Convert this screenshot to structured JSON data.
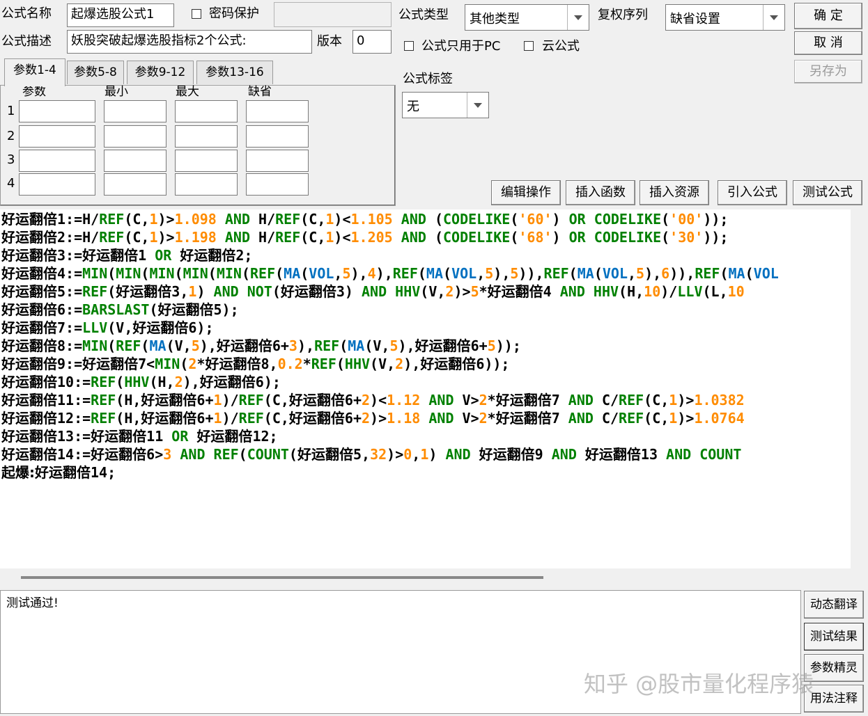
{
  "form": {
    "name_label": "公式名称",
    "name_value": "起爆选股公式1",
    "password_label": "密码保护",
    "desc_label": "公式描述",
    "desc_value": "妖股突破起爆选股指标2个公式:",
    "version_label": "版本",
    "version_value": "0",
    "type_label": "公式类型",
    "type_value": "其他类型",
    "rights_label": "复权序列",
    "rights_value": "缺省设置",
    "pc_only_label": "公式只用于PC",
    "cloud_label": "云公式",
    "tag_label": "公式标签",
    "tag_value": "无"
  },
  "buttons": {
    "ok": "确 定",
    "cancel": "取 消",
    "save_as": "另存为",
    "edit_ops": "编辑操作",
    "insert_func": "插入函数",
    "insert_res": "插入资源",
    "import_formula": "引入公式",
    "test_formula": "测试公式",
    "dyn_translate": "动态翻译",
    "test_result": "测试结果",
    "param_wizard": "参数精灵",
    "usage_notes": "用法注释"
  },
  "tabs": [
    "参数1-4",
    "参数5-8",
    "参数9-12",
    "参数13-16"
  ],
  "params": {
    "headers": [
      "参数",
      "最小",
      "最大",
      "缺省"
    ],
    "rows": [
      "1",
      "2",
      "3",
      "4"
    ]
  },
  "code_lines": [
    [
      [
        "好运翻倍",
        "cn"
      ],
      [
        "1:=H/",
        "t"
      ],
      [
        "REF",
        "fn"
      ],
      [
        "(C,",
        "t"
      ],
      [
        "1",
        "num"
      ],
      [
        ")>",
        "t"
      ],
      [
        "1.098",
        "num"
      ],
      [
        " ",
        "t"
      ],
      [
        "AND",
        "kw"
      ],
      [
        " H/",
        "t"
      ],
      [
        "REF",
        "fn"
      ],
      [
        "(C,",
        "t"
      ],
      [
        "1",
        "num"
      ],
      [
        ")<",
        "t"
      ],
      [
        "1.105",
        "num"
      ],
      [
        " ",
        "t"
      ],
      [
        "AND",
        "kw"
      ],
      [
        " (",
        "t"
      ],
      [
        "CODELIKE",
        "fn"
      ],
      [
        "(",
        "t"
      ],
      [
        "'60'",
        "str"
      ],
      [
        ") ",
        "t"
      ],
      [
        "OR",
        "kw"
      ],
      [
        " ",
        "t"
      ],
      [
        "CODELIKE",
        "fn"
      ],
      [
        "(",
        "t"
      ],
      [
        "'00'",
        "str"
      ],
      [
        "));",
        "t"
      ]
    ],
    [
      [
        "好运翻倍",
        "cn"
      ],
      [
        "2:=H/",
        "t"
      ],
      [
        "REF",
        "fn"
      ],
      [
        "(C,",
        "t"
      ],
      [
        "1",
        "num"
      ],
      [
        ")>",
        "t"
      ],
      [
        "1.198",
        "num"
      ],
      [
        " ",
        "t"
      ],
      [
        "AND",
        "kw"
      ],
      [
        " H/",
        "t"
      ],
      [
        "REF",
        "fn"
      ],
      [
        "(C,",
        "t"
      ],
      [
        "1",
        "num"
      ],
      [
        ")<",
        "t"
      ],
      [
        "1.205",
        "num"
      ],
      [
        " ",
        "t"
      ],
      [
        "AND",
        "kw"
      ],
      [
        " (",
        "t"
      ],
      [
        "CODELIKE",
        "fn"
      ],
      [
        "(",
        "t"
      ],
      [
        "'68'",
        "str"
      ],
      [
        ") ",
        "t"
      ],
      [
        "OR",
        "kw"
      ],
      [
        " ",
        "t"
      ],
      [
        "CODELIKE",
        "fn"
      ],
      [
        "(",
        "t"
      ],
      [
        "'30'",
        "str"
      ],
      [
        "));",
        "t"
      ]
    ],
    [
      [
        "好运翻倍",
        "cn"
      ],
      [
        "3:=",
        "t"
      ],
      [
        "好运翻倍",
        "cn"
      ],
      [
        "1 ",
        "t"
      ],
      [
        "OR",
        "kw"
      ],
      [
        " ",
        "t"
      ],
      [
        "好运翻倍",
        "cn"
      ],
      [
        "2;",
        "t"
      ]
    ],
    [
      [
        "好运翻倍",
        "cn"
      ],
      [
        "4:=",
        "t"
      ],
      [
        "MIN",
        "fn"
      ],
      [
        "(",
        "t"
      ],
      [
        "MIN",
        "fn"
      ],
      [
        "(",
        "t"
      ],
      [
        "MIN",
        "fn"
      ],
      [
        "(",
        "t"
      ],
      [
        "MIN",
        "fn"
      ],
      [
        "(",
        "t"
      ],
      [
        "MIN",
        "fn"
      ],
      [
        "(",
        "t"
      ],
      [
        "REF",
        "fn"
      ],
      [
        "(",
        "t"
      ],
      [
        "MA",
        "var"
      ],
      [
        "(",
        "t"
      ],
      [
        "VOL",
        "var"
      ],
      [
        ",",
        "t"
      ],
      [
        "5",
        "num"
      ],
      [
        "),",
        "t"
      ],
      [
        "4",
        "num"
      ],
      [
        "),",
        "t"
      ],
      [
        "REF",
        "fn"
      ],
      [
        "(",
        "t"
      ],
      [
        "MA",
        "var"
      ],
      [
        "(",
        "t"
      ],
      [
        "VOL",
        "var"
      ],
      [
        ",",
        "t"
      ],
      [
        "5",
        "num"
      ],
      [
        "),",
        "t"
      ],
      [
        "5",
        "num"
      ],
      [
        ")),",
        "t"
      ],
      [
        "REF",
        "fn"
      ],
      [
        "(",
        "t"
      ],
      [
        "MA",
        "var"
      ],
      [
        "(",
        "t"
      ],
      [
        "VOL",
        "var"
      ],
      [
        ",",
        "t"
      ],
      [
        "5",
        "num"
      ],
      [
        "),",
        "t"
      ],
      [
        "6",
        "num"
      ],
      [
        ")),",
        "t"
      ],
      [
        "REF",
        "fn"
      ],
      [
        "(",
        "t"
      ],
      [
        "MA",
        "var"
      ],
      [
        "(",
        "t"
      ],
      [
        "VOL",
        "var"
      ]
    ],
    [
      [
        "好运翻倍",
        "cn"
      ],
      [
        "5:=",
        "t"
      ],
      [
        "REF",
        "fn"
      ],
      [
        "(",
        "t"
      ],
      [
        "好运翻倍",
        "cn"
      ],
      [
        "3,",
        "t"
      ],
      [
        "1",
        "num"
      ],
      [
        ") ",
        "t"
      ],
      [
        "AND",
        "kw"
      ],
      [
        " ",
        "t"
      ],
      [
        "NOT",
        "kw"
      ],
      [
        "(",
        "t"
      ],
      [
        "好运翻倍",
        "cn"
      ],
      [
        "3) ",
        "t"
      ],
      [
        "AND",
        "kw"
      ],
      [
        " ",
        "t"
      ],
      [
        "HHV",
        "fn"
      ],
      [
        "(V,",
        "t"
      ],
      [
        "2",
        "num"
      ],
      [
        ")>",
        "t"
      ],
      [
        "5",
        "num"
      ],
      [
        "*",
        "t"
      ],
      [
        "好运翻倍",
        "cn"
      ],
      [
        "4 ",
        "t"
      ],
      [
        "AND",
        "kw"
      ],
      [
        " ",
        "t"
      ],
      [
        "HHV",
        "fn"
      ],
      [
        "(H,",
        "t"
      ],
      [
        "10",
        "num"
      ],
      [
        ")/",
        "t"
      ],
      [
        "LLV",
        "fn"
      ],
      [
        "(L,",
        "t"
      ],
      [
        "10",
        "num"
      ]
    ],
    [
      [
        "好运翻倍",
        "cn"
      ],
      [
        "6:=",
        "t"
      ],
      [
        "BARSLAST",
        "fn"
      ],
      [
        "(",
        "t"
      ],
      [
        "好运翻倍",
        "cn"
      ],
      [
        "5);",
        "t"
      ]
    ],
    [
      [
        "好运翻倍",
        "cn"
      ],
      [
        "7:=",
        "t"
      ],
      [
        "LLV",
        "fn"
      ],
      [
        "(V,",
        "t"
      ],
      [
        "好运翻倍",
        "cn"
      ],
      [
        "6);",
        "t"
      ]
    ],
    [
      [
        "好运翻倍",
        "cn"
      ],
      [
        "8:=",
        "t"
      ],
      [
        "MIN",
        "fn"
      ],
      [
        "(",
        "t"
      ],
      [
        "REF",
        "fn"
      ],
      [
        "(",
        "t"
      ],
      [
        "MA",
        "var"
      ],
      [
        "(V,",
        "t"
      ],
      [
        "5",
        "num"
      ],
      [
        "),",
        "t"
      ],
      [
        "好运翻倍",
        "cn"
      ],
      [
        "6+",
        "t"
      ],
      [
        "3",
        "num"
      ],
      [
        "),",
        "t"
      ],
      [
        "REF",
        "fn"
      ],
      [
        "(",
        "t"
      ],
      [
        "MA",
        "var"
      ],
      [
        "(V,",
        "t"
      ],
      [
        "5",
        "num"
      ],
      [
        "),",
        "t"
      ],
      [
        "好运翻倍",
        "cn"
      ],
      [
        "6+",
        "t"
      ],
      [
        "5",
        "num"
      ],
      [
        "));",
        "t"
      ]
    ],
    [
      [
        "好运翻倍",
        "cn"
      ],
      [
        "9:=",
        "t"
      ],
      [
        "好运翻倍",
        "cn"
      ],
      [
        "7<",
        "t"
      ],
      [
        "MIN",
        "fn"
      ],
      [
        "(",
        "t"
      ],
      [
        "2",
        "num"
      ],
      [
        "*",
        "t"
      ],
      [
        "好运翻倍",
        "cn"
      ],
      [
        "8,",
        "t"
      ],
      [
        "0.2",
        "num"
      ],
      [
        "*",
        "t"
      ],
      [
        "REF",
        "fn"
      ],
      [
        "(",
        "t"
      ],
      [
        "HHV",
        "fn"
      ],
      [
        "(V,",
        "t"
      ],
      [
        "2",
        "num"
      ],
      [
        "),",
        "t"
      ],
      [
        "好运翻倍",
        "cn"
      ],
      [
        "6));",
        "t"
      ]
    ],
    [
      [
        "好运翻倍",
        "cn"
      ],
      [
        "10:=",
        "t"
      ],
      [
        "REF",
        "fn"
      ],
      [
        "(",
        "t"
      ],
      [
        "HHV",
        "fn"
      ],
      [
        "(H,",
        "t"
      ],
      [
        "2",
        "num"
      ],
      [
        "),",
        "t"
      ],
      [
        "好运翻倍",
        "cn"
      ],
      [
        "6);",
        "t"
      ]
    ],
    [
      [
        "好运翻倍",
        "cn"
      ],
      [
        "11:=",
        "t"
      ],
      [
        "REF",
        "fn"
      ],
      [
        "(H,",
        "t"
      ],
      [
        "好运翻倍",
        "cn"
      ],
      [
        "6+",
        "t"
      ],
      [
        "1",
        "num"
      ],
      [
        ")/",
        "t"
      ],
      [
        "REF",
        "fn"
      ],
      [
        "(C,",
        "t"
      ],
      [
        "好运翻倍",
        "cn"
      ],
      [
        "6+",
        "t"
      ],
      [
        "2",
        "num"
      ],
      [
        ")<",
        "t"
      ],
      [
        "1.12",
        "num"
      ],
      [
        " ",
        "t"
      ],
      [
        "AND",
        "kw"
      ],
      [
        " V>",
        "t"
      ],
      [
        "2",
        "num"
      ],
      [
        "*",
        "t"
      ],
      [
        "好运翻倍",
        "cn"
      ],
      [
        "7 ",
        "t"
      ],
      [
        "AND",
        "kw"
      ],
      [
        " C/",
        "t"
      ],
      [
        "REF",
        "fn"
      ],
      [
        "(C,",
        "t"
      ],
      [
        "1",
        "num"
      ],
      [
        ")>",
        "t"
      ],
      [
        "1.0382",
        "num"
      ]
    ],
    [
      [
        "好运翻倍",
        "cn"
      ],
      [
        "12:=",
        "t"
      ],
      [
        "REF",
        "fn"
      ],
      [
        "(H,",
        "t"
      ],
      [
        "好运翻倍",
        "cn"
      ],
      [
        "6+",
        "t"
      ],
      [
        "1",
        "num"
      ],
      [
        ")/",
        "t"
      ],
      [
        "REF",
        "fn"
      ],
      [
        "(C,",
        "t"
      ],
      [
        "好运翻倍",
        "cn"
      ],
      [
        "6+",
        "t"
      ],
      [
        "2",
        "num"
      ],
      [
        ")>",
        "t"
      ],
      [
        "1.18",
        "num"
      ],
      [
        " ",
        "t"
      ],
      [
        "AND",
        "kw"
      ],
      [
        " V>",
        "t"
      ],
      [
        "2",
        "num"
      ],
      [
        "*",
        "t"
      ],
      [
        "好运翻倍",
        "cn"
      ],
      [
        "7 ",
        "t"
      ],
      [
        "AND",
        "kw"
      ],
      [
        " C/",
        "t"
      ],
      [
        "REF",
        "fn"
      ],
      [
        "(C,",
        "t"
      ],
      [
        "1",
        "num"
      ],
      [
        ")>",
        "t"
      ],
      [
        "1.0764",
        "num"
      ]
    ],
    [
      [
        "好运翻倍",
        "cn"
      ],
      [
        "13:=",
        "t"
      ],
      [
        "好运翻倍",
        "cn"
      ],
      [
        "11 ",
        "t"
      ],
      [
        "OR",
        "kw"
      ],
      [
        " ",
        "t"
      ],
      [
        "好运翻倍",
        "cn"
      ],
      [
        "12;",
        "t"
      ]
    ],
    [
      [
        "好运翻倍",
        "cn"
      ],
      [
        "14:=",
        "t"
      ],
      [
        "好运翻倍",
        "cn"
      ],
      [
        "6>",
        "t"
      ],
      [
        "3",
        "num"
      ],
      [
        " ",
        "t"
      ],
      [
        "AND",
        "kw"
      ],
      [
        " ",
        "t"
      ],
      [
        "REF",
        "fn"
      ],
      [
        "(",
        "t"
      ],
      [
        "COUNT",
        "fn"
      ],
      [
        "(",
        "t"
      ],
      [
        "好运翻倍",
        "cn"
      ],
      [
        "5,",
        "t"
      ],
      [
        "32",
        "num"
      ],
      [
        ")>",
        "t"
      ],
      [
        "0",
        "num"
      ],
      [
        ",",
        "t"
      ],
      [
        "1",
        "num"
      ],
      [
        ") ",
        "t"
      ],
      [
        "AND",
        "kw"
      ],
      [
        " ",
        "t"
      ],
      [
        "好运翻倍",
        "cn"
      ],
      [
        "9 ",
        "t"
      ],
      [
        "AND",
        "kw"
      ],
      [
        " ",
        "t"
      ],
      [
        "好运翻倍",
        "cn"
      ],
      [
        "13 ",
        "t"
      ],
      [
        "AND",
        "kw"
      ],
      [
        " ",
        "t"
      ],
      [
        "COUNT",
        "fn"
      ]
    ],
    [
      [
        "起爆:",
        "cn"
      ],
      [
        "好运翻倍",
        "cn"
      ],
      [
        "14;",
        "t"
      ]
    ]
  ],
  "output_text": "测试通过!",
  "watermark": "知乎 @股市量化程序猿",
  "colors": {
    "keyword": "#008000",
    "number": "#ff8c00",
    "variable": "#0070c0"
  }
}
